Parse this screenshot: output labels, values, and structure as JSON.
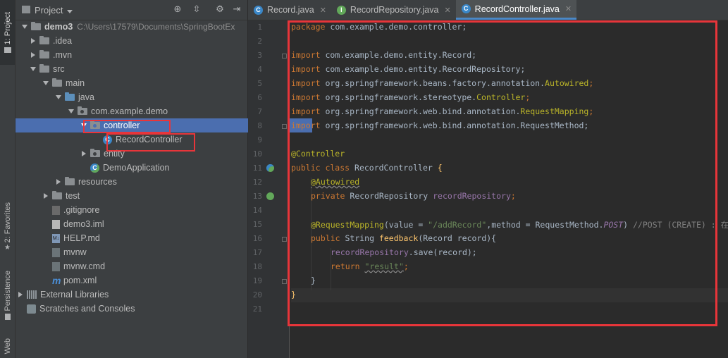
{
  "stripe": {
    "project_tab": "1: Project",
    "favorites_tab": "2: Favorites",
    "persistence_tab": "Persistence",
    "web_tab": "Web"
  },
  "panel": {
    "title": "Project"
  },
  "tree": [
    {
      "label": "demo3",
      "path": "C:\\Users\\17579\\Documents\\SpringBootEx"
    },
    {
      "label": ".idea"
    },
    {
      "label": ".mvn"
    },
    {
      "label": "src"
    },
    {
      "label": "main"
    },
    {
      "label": "java"
    },
    {
      "label": "com.example.demo"
    },
    {
      "label": "controller"
    },
    {
      "label": "RecordController"
    },
    {
      "label": "entity"
    },
    {
      "label": "DemoApplication"
    },
    {
      "label": "resources"
    },
    {
      "label": "test"
    },
    {
      "label": ".gitignore"
    },
    {
      "label": "demo3.iml"
    },
    {
      "label": "HELP.md"
    },
    {
      "label": "mvnw"
    },
    {
      "label": "mvnw.cmd"
    },
    {
      "label": "pom.xml"
    },
    {
      "label": "External Libraries"
    },
    {
      "label": "Scratches and Consoles"
    }
  ],
  "tabs": [
    {
      "label": "Record.java",
      "icon_letter": "C",
      "color": "#3a87c8"
    },
    {
      "label": "RecordRepository.java",
      "icon_letter": "I",
      "color": "#62a85a"
    },
    {
      "label": "RecordController.java",
      "icon_letter": "C",
      "color": "#3a87c8"
    }
  ],
  "line_numbers": [
    "1",
    "2",
    "3",
    "4",
    "5",
    "6",
    "7",
    "8",
    "9",
    "10",
    "11",
    "12",
    "13",
    "14",
    "15",
    "16",
    "17",
    "18",
    "19",
    "20",
    "21"
  ],
  "code": {
    "l1_kw": "package",
    "l1_rest": " com.example.demo.controller;",
    "l3_kw": "import",
    "l3_rest": " com.example.demo.entity.Record;",
    "l4_kw": "import",
    "l4_rest": " com.example.demo.entity.RecordRepository;",
    "l5_kw": "import",
    "l5_rest": " org.springframework.beans.factory.annotation.",
    "l5_ann": "Autowired",
    "l5_end": ";",
    "l6_kw": "import",
    "l6_rest": " org.springframework.stereotype.",
    "l6_ann": "Controller",
    "l6_end": ";",
    "l7_kw": "import",
    "l7_rest": " org.springframework.web.bind.annotation.",
    "l7_ann": "RequestMapping",
    "l7_end": ";",
    "l8_kw": "import",
    "l8_rest": " org.springframework.web.bind.annotation.RequestMethod;",
    "l10_ann": "@Controller",
    "l11_kw": "public class",
    "l11_rest": " RecordController ",
    "l11_brace": "{",
    "l12_ann": "@Autowired",
    "l13_kw": "private",
    "l13_rest": " RecordRepository ",
    "l13_fld": "recordRepository",
    "l13_end": ";",
    "l15_ann": "@RequestMapping",
    "l15_a": "(value = ",
    "l15_str": "\"/addRecord\"",
    "l15_b": ",method = RequestMethod.",
    "l15_const": "POST",
    "l15_c": ") ",
    "l15_cmt": "//POST (CREATE) : 在",
    "l16_kw": "public",
    "l16_rest": " String ",
    "l16_fn": "feedback",
    "l16_end": "(Record record){",
    "l17_fld": "recordRepository",
    "l17_rest": ".save(record);",
    "l18_kw": "return",
    "l18_sp": " ",
    "l18_str": "\"result\"",
    "l18_end": ";",
    "l19": "}",
    "l20": "}"
  },
  "colors": {
    "selection": "#4b6eaf",
    "highlight_box": "#e8353a",
    "keyword": "#cc7832",
    "annotation": "#bbb529",
    "string": "#6a8759",
    "field": "#9876aa"
  }
}
